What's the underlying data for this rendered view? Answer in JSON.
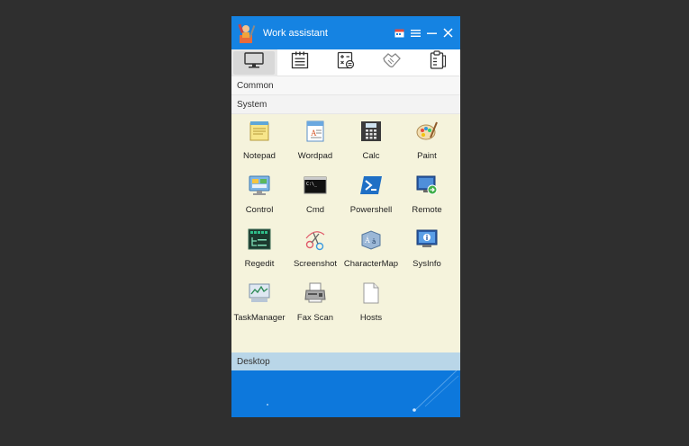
{
  "window": {
    "title": "Work assistant",
    "icons": {
      "logo": "tools-figure-icon",
      "calendar": "calendar-icon",
      "menu": "hamburger-menu-icon",
      "minimize": "minimize-icon",
      "close": "close-icon"
    }
  },
  "tabs": [
    {
      "icon": "monitor-icon",
      "active": true
    },
    {
      "icon": "notes-list-icon",
      "active": false
    },
    {
      "icon": "calculator-doc-icon",
      "active": false
    },
    {
      "icon": "handshake-icon",
      "active": false
    },
    {
      "icon": "clipboard-checklist-icon",
      "active": false
    }
  ],
  "sections": {
    "common": "Common",
    "system": "System",
    "desktop": "Desktop"
  },
  "apps": [
    {
      "label": "Notepad",
      "icon": "notepad-icon"
    },
    {
      "label": "Wordpad",
      "icon": "wordpad-icon"
    },
    {
      "label": "Calc",
      "icon": "calculator-icon"
    },
    {
      "label": "Paint",
      "icon": "paint-palette-icon"
    },
    {
      "label": "Control",
      "icon": "control-panel-icon"
    },
    {
      "label": "Cmd",
      "icon": "command-prompt-icon"
    },
    {
      "label": "Powershell",
      "icon": "powershell-icon"
    },
    {
      "label": "Remote",
      "icon": "remote-desktop-icon"
    },
    {
      "label": "Regedit",
      "icon": "registry-editor-icon"
    },
    {
      "label": "Screenshot",
      "icon": "scissors-icon"
    },
    {
      "label": "CharacterMap",
      "icon": "character-map-icon"
    },
    {
      "label": "SysInfo",
      "icon": "system-info-icon"
    },
    {
      "label": "TaskManager",
      "icon": "task-manager-icon"
    },
    {
      "label": "Fax Scan",
      "icon": "fax-scanner-icon"
    },
    {
      "label": "Hosts",
      "icon": "blank-file-icon"
    }
  ],
  "colors": {
    "titlebar": "#1583e2",
    "background": "#2f2f2f",
    "panel": "#f5f3dc",
    "desktop_header": "#b9d6e8",
    "desktop_area": "#0d78dc"
  }
}
